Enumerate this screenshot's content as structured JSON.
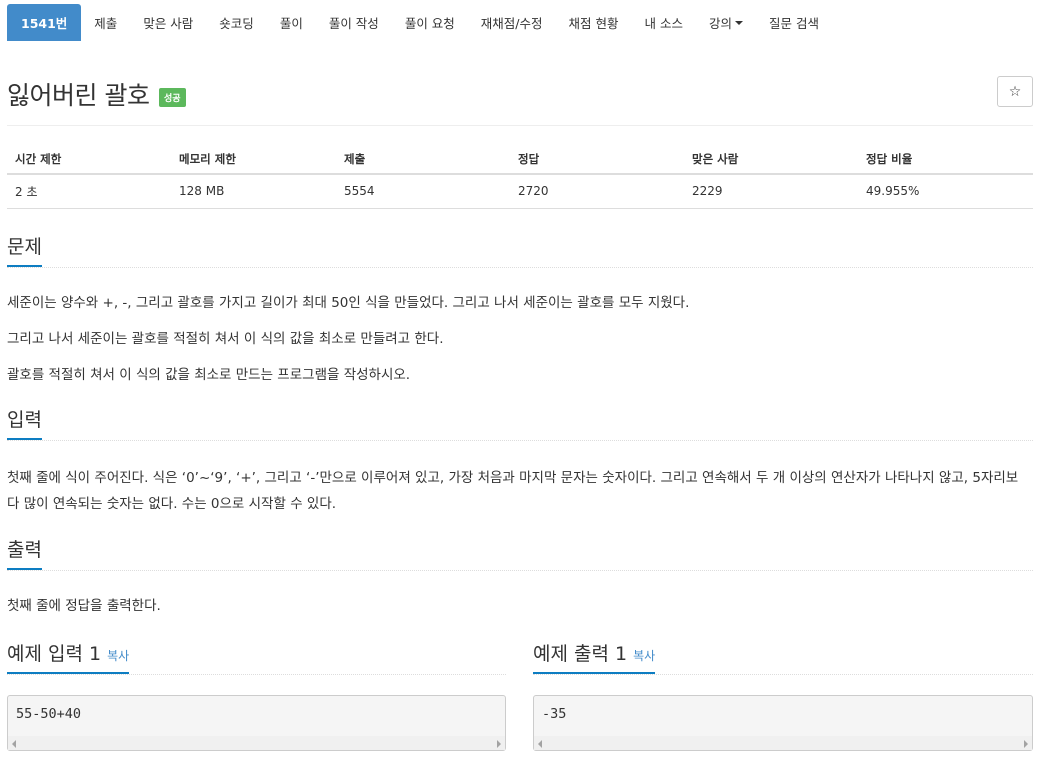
{
  "nav": {
    "items": [
      "1541번",
      "제출",
      "맞은 사람",
      "숏코딩",
      "풀이",
      "풀이 작성",
      "풀이 요청",
      "재채점/수정",
      "채점 현황",
      "내 소스",
      "강의",
      "질문 검색"
    ]
  },
  "problem": {
    "title": "잃어버린 괄호",
    "badge": "성공",
    "star": "☆"
  },
  "info": {
    "headers": [
      "시간 제한",
      "메모리 제한",
      "제출",
      "정답",
      "맞은 사람",
      "정답 비율"
    ],
    "values": [
      "2 초",
      "128 MB",
      "5554",
      "2720",
      "2229",
      "49.955%"
    ]
  },
  "sections": {
    "problem_title": "문제",
    "problem_lines": [
      "세준이는 양수와 +, -, 그리고 괄호를 가지고 길이가 최대 50인 식을 만들었다. 그리고 나서 세준이는 괄호를 모두 지웠다.",
      "그리고 나서 세준이는 괄호를 적절히 쳐서 이 식의 값을 최소로 만들려고 한다.",
      "괄호를 적절히 쳐서 이 식의 값을 최소로 만드는 프로그램을 작성하시오."
    ],
    "input_title": "입력",
    "input_lines": [
      "첫째 줄에 식이 주어진다. 식은 ‘0’~‘9’, ‘+’, 그리고 ‘-’만으로 이루어져 있고, 가장 처음과 마지막 문자는 숫자이다. 그리고 연속해서 두 개 이상의 연산자가 나타나지 않고, 5자리보",
      "다 많이 연속되는 숫자는 없다. 수는 0으로 시작할 수 있다."
    ],
    "output_title": "출력",
    "output_lines": [
      "첫째 줄에 정답을 출력한다."
    ]
  },
  "samples": {
    "input_title": "예제 입력 1",
    "output_title": "예제 출력 1",
    "copy_label": "복사",
    "input": "55-50+40",
    "output": "-35"
  },
  "colors": {
    "nav_active": "#428bca",
    "badge": "#5cb85c",
    "section_underline": "#0d7dc2",
    "link": "#428bca"
  }
}
